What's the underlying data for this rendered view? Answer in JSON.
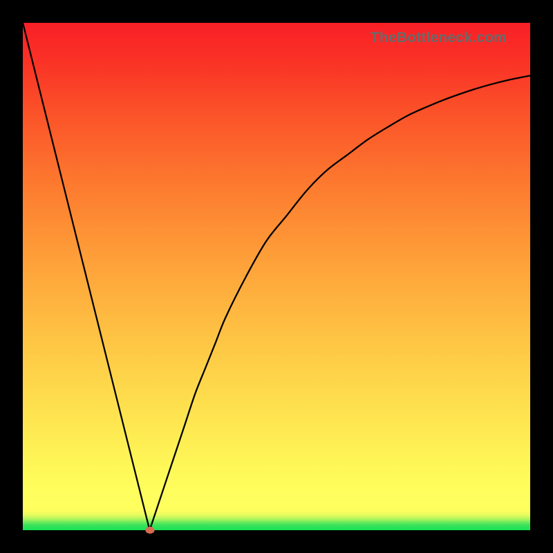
{
  "attribution": "TheBottleneck.com",
  "chart_data": {
    "type": "line",
    "title": "",
    "xlabel": "",
    "ylabel": "",
    "xlim": [
      0,
      100
    ],
    "ylim": [
      0,
      100
    ],
    "grid": false,
    "series": [
      {
        "name": "bottleneck-curve",
        "x": [
          0,
          2,
          4,
          6,
          8,
          10,
          12,
          14,
          16,
          18,
          20,
          22,
          24,
          25,
          26,
          28,
          30,
          32,
          34,
          36,
          38,
          40,
          44,
          48,
          52,
          56,
          60,
          64,
          68,
          72,
          76,
          80,
          84,
          88,
          92,
          96,
          100
        ],
        "y": [
          100,
          92,
          84,
          76,
          68,
          60,
          52,
          44,
          36,
          28,
          20,
          12,
          4,
          0,
          3,
          9,
          15,
          21,
          27,
          32,
          37,
          42,
          50,
          57,
          62,
          67,
          71,
          74,
          77,
          79.5,
          81.8,
          83.6,
          85.2,
          86.6,
          87.8,
          88.8,
          89.6
        ]
      }
    ],
    "marker": {
      "x": 25,
      "y": 0,
      "color": "#d96a54"
    },
    "background_gradient": {
      "type": "vertical",
      "stops": [
        {
          "pos": 0.0,
          "color": "#17e156"
        },
        {
          "pos": 0.04,
          "color": "#fdff5e"
        },
        {
          "pos": 0.07,
          "color": "#feff5e"
        },
        {
          "pos": 0.36,
          "color": "#fec845"
        },
        {
          "pos": 0.68,
          "color": "#fd7a2f"
        },
        {
          "pos": 1.0,
          "color": "#f91f26"
        }
      ]
    }
  }
}
